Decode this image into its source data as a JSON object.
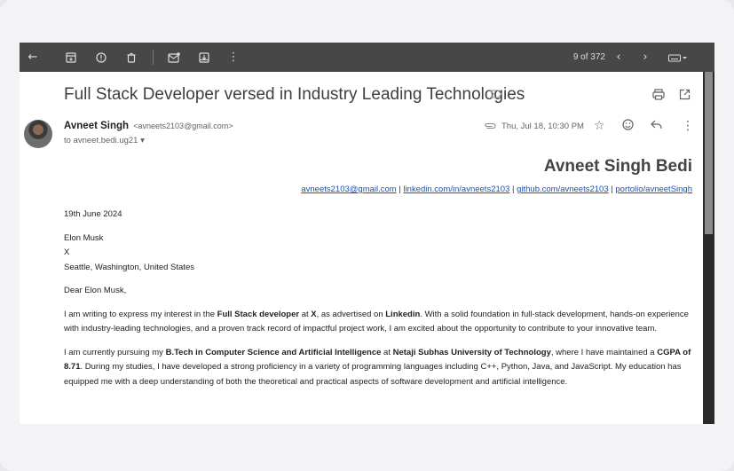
{
  "toolbar": {
    "back_icon": "arrow-left",
    "count": "9 of 372"
  },
  "email": {
    "subject": "Full Stack Developer versed in Industry Leading Technologies",
    "sender_name": "Avneet Singh",
    "sender_email": "<avneets2103@gmail.com>",
    "to": "to avneet.bedi.ug21 ▾",
    "date": "Thu, Jul 18, 10:30 PM"
  },
  "letter": {
    "name": "Avneet Singh Bedi",
    "links": [
      "avneets2103@gmail.com",
      "linkedin.com/in/avneets2103",
      "github.com/avneets2103",
      "portolio/avneetSingh"
    ],
    "link_sep": " | ",
    "date": "19th June 2024",
    "recipient_name": "Elon Musk",
    "recipient_company": "X",
    "recipient_location": "Seattle, Washington, United States",
    "salutation": "Dear Elon Musk,",
    "p1_a": "I am writing to express my interest in the ",
    "p1_b": "Full Stack developer",
    "p1_c": " at ",
    "p1_d": "X",
    "p1_e": ", as advertised on ",
    "p1_f": "Linkedin",
    "p1_g": ". With a solid foundation in full-stack development, hands-on experience with industry-leading technologies, and a proven track record of impactful project work, I am excited about the opportunity to contribute to your innovative team.",
    "p2_a": "I am currently pursuing my ",
    "p2_b": "B.Tech in Computer Science and Artificial Intelligence",
    "p2_c": " at ",
    "p2_d": "Netaji Subhas University of Technology",
    "p2_e": ", where I have maintained a ",
    "p2_f": "CGPA of 8.71",
    "p2_g": ". During my studies, I have developed a strong proficiency in a variety of programming languages including C++, Python, Java, and JavaScript. My education has equipped me with a deep understanding of both the theoretical and practical aspects of software development and artificial intelligence."
  },
  "colors": {
    "toolbar_bg": "#474747",
    "link": "#1a4fb5"
  }
}
